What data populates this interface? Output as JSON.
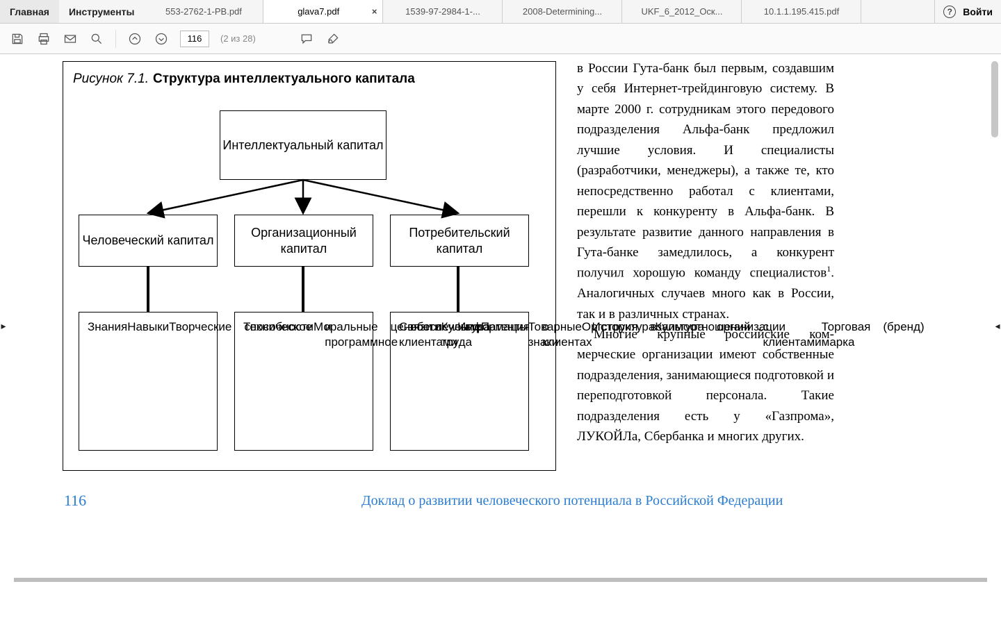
{
  "menu": {
    "home": "Главная",
    "tools": "Инструменты"
  },
  "tabs": [
    {
      "label": "553-2762-1-PB.pdf",
      "active": false
    },
    {
      "label": "glava7.pdf",
      "active": true
    },
    {
      "label": "1539-97-2984-1-...",
      "active": false
    },
    {
      "label": "2008-Determining...",
      "active": false
    },
    {
      "label": "UKF_6_2012_Оск...",
      "active": false
    },
    {
      "label": "10.1.1.195.415.pdf",
      "active": false
    }
  ],
  "login": "Войти",
  "toolbar": {
    "page_value": "116",
    "page_count_label": "(2 из 28)"
  },
  "figure": {
    "caption_num": "Рисунок 7.1.",
    "caption_title": "Структура интеллектуального капитала",
    "root": "Интеллектуальный капитал",
    "cols": [
      {
        "head": "Человеческий капитал",
        "items": [
          "Знания",
          "Навыки",
          "Творческие",
          "  способности",
          "Моральные",
          "  ценности",
          "Культура труда"
        ]
      },
      {
        "head": "Организационный капитал",
        "items": [
          "Техническое",
          "  и программное",
          "  обеспечение",
          "Патенты",
          "Товарные знаки",
          "Оргструктура",
          "Культура",
          "  организации"
        ]
      },
      {
        "head": "Потребительский капитал",
        "items": [
          "Связи с клиентами",
          "Информация",
          "  о клиентах",
          "История",
          "  взаимоотношений",
          "  с клиентами",
          "Торговая марка",
          "  (бренд)"
        ]
      }
    ]
  },
  "body": {
    "p1": "в России Гута-банк был первым, со­здавшим у себя Интернет-трейдинго­вую систему. В марте 2000 г. сотрудни­кам этого передового подразделения Альфа-банк предложил лучшие усло­вия. И специалисты (разработчики, менеджеры), а также те, кто непосред­ственно работал с клиентами, перешли к конкуренту в Альфа-банк. В резуль­тате развитие данного направления в Гута-банке замедлилось, а конкурент получил хорошую команду специалис­тов",
    "p1_tail": ". Аналогичных случаев много как в России, так и в различных странах.",
    "footnote_mark": "1",
    "p2": "Многие крупные российские ком­мерческие организации имеют соб­ственные подразделения, занимающиеся подготовкой и переподготовкой персо­нала. Такие подразделения есть у «Газ­прома», ЛУКОЙЛа, Сбербанка и мно­гих других."
  },
  "page_number": "116",
  "footer_title": "Доклад о развитии человеческого потенциала в Российской Федерации"
}
